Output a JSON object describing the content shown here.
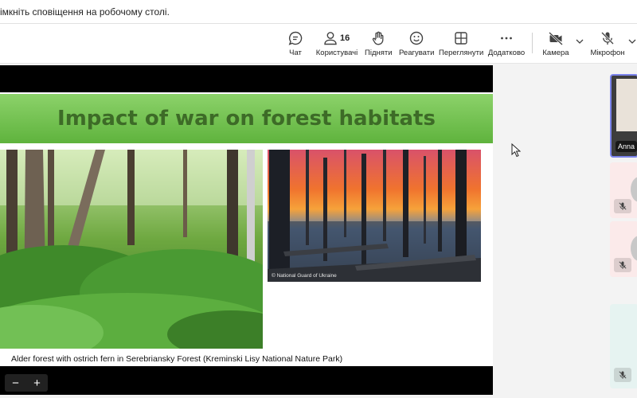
{
  "notification": {
    "text": "імкніть сповіщення на робочому столі."
  },
  "toolbar": {
    "chat": "Чат",
    "people": "Користувачі",
    "people_count": "16",
    "raise": "Підняти",
    "react": "Реагувати",
    "view": "Переглянути",
    "more": "Додатково",
    "camera": "Камера",
    "mic": "Мікрофон"
  },
  "slide": {
    "title": "Impact of war on forest habitats",
    "photo_credit": "© National Guard of Ukraine",
    "caption": "Alder forest with ostrich fern in Serebriansky Forest (Kreminski Lisy National Nature Park)"
  },
  "zoom": {
    "minus": "−",
    "plus": "+"
  },
  "participants": [
    {
      "name": "Anna"
    }
  ],
  "colors": {
    "banner": "#6cbf47",
    "title": "#3d6b27",
    "accent": "#7b83eb"
  }
}
